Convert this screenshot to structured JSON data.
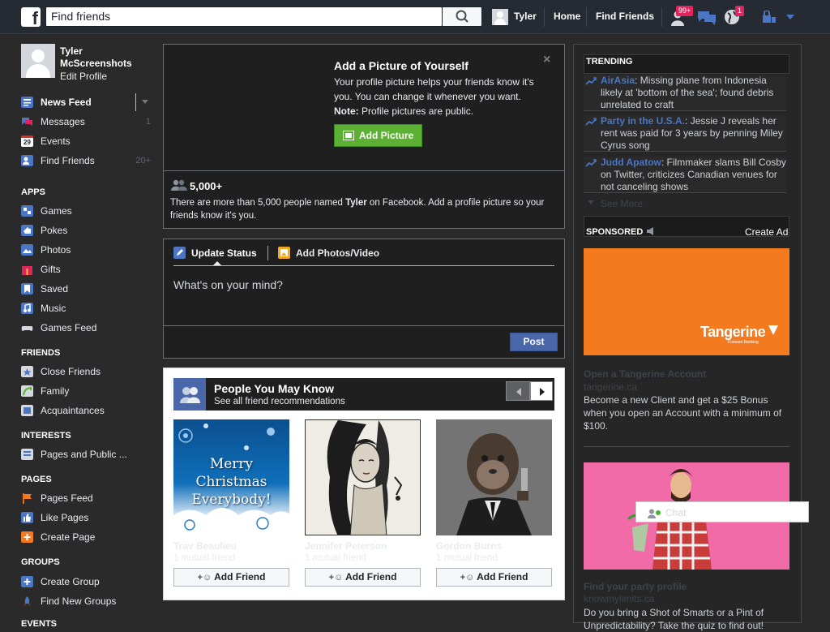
{
  "topbar": {
    "logo": "f",
    "search_placeholder": "Find friends",
    "user_name": "Tyler",
    "home_label": "Home",
    "find_friends_label": "Find Friends",
    "friend_requests_badge": "99+",
    "notifications_badge": "1"
  },
  "profile": {
    "name": "Tyler McScreenshots",
    "edit_label": "Edit Profile"
  },
  "nav": {
    "favorites": [
      {
        "label": "News Feed",
        "count": ""
      },
      {
        "label": "Messages",
        "count": "1"
      },
      {
        "label": "Events",
        "count": "",
        "icon_text": "29"
      },
      {
        "label": "Find Friends",
        "count": "20+"
      }
    ],
    "apps_title": "APPS",
    "apps": [
      "Games",
      "Pokes",
      "Photos",
      "Gifts",
      "Saved",
      "Music",
      "Games Feed"
    ],
    "friends_title": "FRIENDS",
    "friends": [
      "Close Friends",
      "Family",
      "Acquaintances"
    ],
    "interests_title": "INTERESTS",
    "interests": [
      "Pages and Public ..."
    ],
    "pages_title": "PAGES",
    "pages": [
      "Pages Feed",
      "Like Pages",
      "Create Page"
    ],
    "groups_title": "GROUPS",
    "groups": [
      "Create Group",
      "Find New Groups"
    ],
    "events_title": "EVENTS"
  },
  "picture_card": {
    "title": "Add a Picture of Yourself",
    "body": "Your profile picture helps your friends know it's you. You can change it whenever you want.",
    "note_label": "Note:",
    "note_text": " Profile pictures are public.",
    "button": "Add Picture",
    "close": "×",
    "count": "5,000+",
    "desc_before": "There are more than 5,000 people named ",
    "desc_name": "Tyler",
    "desc_after": " on Facebook. Add a profile picture so your friends know it's you."
  },
  "composer": {
    "tab_status": "Update Status",
    "tab_photos": "Add Photos/Video",
    "placeholder": "What's on your mind?",
    "post_button": "Post"
  },
  "pymk": {
    "title": "People You May Know",
    "subtitle": "See all friend recommendations",
    "add_friend_label": "Add Friend",
    "people": [
      {
        "name": "Trav Beaulieu",
        "mutual": "1 mutual friend",
        "image": "Merry Christmas Everybody!"
      },
      {
        "name": "Jennifer Peterson",
        "mutual": "1 mutual friend",
        "image": "portrait-illustration"
      },
      {
        "name": "Gordon Burns",
        "mutual": "1 mutual friend",
        "image": "ape-in-suit"
      }
    ]
  },
  "trending": {
    "title": "TRENDING",
    "items": [
      {
        "tag": "AirAsia",
        "text": ": Missing plane from Indonesia likely at 'bottom of the sea'; found debris unrelated to craft"
      },
      {
        "tag": "Party in the U.S.A.",
        "text": ": Jessie J reveals her rent was paid for 3 years by penning Miley Cyrus song"
      },
      {
        "tag": "Judd Apatow",
        "text": ": Filmmaker slams Bill Cosby on Twitter, criticizes Canadian venues for not canceling shows"
      }
    ],
    "see_more": "See More"
  },
  "sponsored": {
    "title": "SPONSORED",
    "create_ad": "Create Ad",
    "ad1": {
      "brand": "Tangerine",
      "brand_tagline": "Forward Banking",
      "title": "Open a Tangerine Account",
      "url": "tangerine.ca",
      "text": "Become a new Client and get a $25 Bonus when you open an Account with a minimum of $100."
    },
    "ad2": {
      "title": "Find your party profile",
      "url": "knowmylimits.ca",
      "text": "Do you bring a Shot of Smarts or a Pint of Unpredictability? Take the quiz to find out!"
    }
  },
  "chat": {
    "placeholder": "Chat"
  },
  "colors": {
    "accent_blue": "#4a76c4",
    "add_picture_green": "#5cb033",
    "badge_red": "#e0245e",
    "tangerine_orange": "#f47a20",
    "pink_ad": "#f06ba7"
  }
}
